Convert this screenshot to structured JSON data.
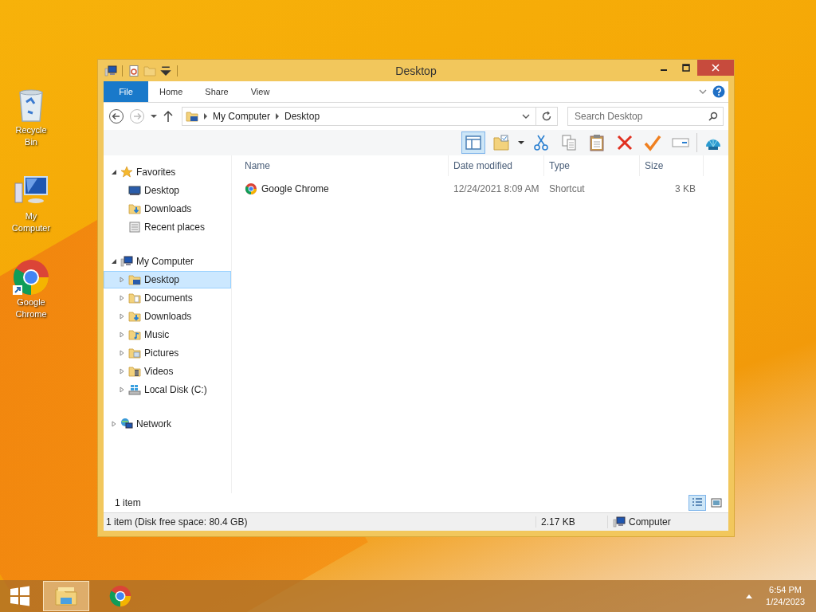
{
  "desktop_icons": [
    {
      "kind": "recycle",
      "label": "Recycle Bin"
    },
    {
      "kind": "computer",
      "label": "My Computer"
    },
    {
      "kind": "chrome",
      "label": "Google Chrome"
    }
  ],
  "window": {
    "title": "Desktop",
    "quick_access": [
      {
        "kind": "properties"
      },
      {
        "kind": "folder"
      }
    ],
    "ribbon_tabs": [
      {
        "label": "File",
        "kind": "menu",
        "selected": false
      },
      {
        "label": "Home",
        "kind": "tab",
        "selected": false
      },
      {
        "label": "Share",
        "kind": "tab",
        "selected": false
      },
      {
        "label": "View",
        "kind": "tab",
        "selected": false
      }
    ],
    "address": {
      "path": [
        "My Computer",
        "Desktop"
      ]
    },
    "search": {
      "placeholder": "Search Desktop"
    },
    "preview_pane": {
      "on": true
    },
    "toolbar": [
      {
        "kind": "newfolder"
      },
      {
        "kind": "cut"
      },
      {
        "kind": "copy"
      },
      {
        "kind": "paste"
      },
      {
        "kind": "delete"
      },
      {
        "kind": "check"
      },
      {
        "kind": "rename"
      },
      {
        "kind": "shell"
      }
    ],
    "nav": [
      {
        "label": "Favorites",
        "kind": "star",
        "expanded": true,
        "selected": false,
        "children": [
          {
            "label": "Desktop",
            "kind": "desktop",
            "selected": false
          },
          {
            "label": "Downloads",
            "kind": "downloads",
            "selected": false
          },
          {
            "label": "Recent places",
            "kind": "recent",
            "selected": false
          }
        ]
      },
      {
        "label": "My Computer",
        "kind": "computer",
        "expanded": true,
        "selected": false,
        "children": [
          {
            "label": "Desktop",
            "kind": "desktopfolder",
            "expanded": false,
            "selected": true
          },
          {
            "label": "Documents",
            "kind": "documents",
            "expanded": false,
            "selected": false
          },
          {
            "label": "Downloads",
            "kind": "downloads",
            "expanded": false,
            "selected": false
          },
          {
            "label": "Music",
            "kind": "music",
            "expanded": false,
            "selected": false
          },
          {
            "label": "Pictures",
            "kind": "pictures",
            "expanded": false,
            "selected": false
          },
          {
            "label": "Videos",
            "kind": "videos",
            "expanded": false,
            "selected": false
          },
          {
            "label": "Local Disk (C:)",
            "kind": "drive",
            "expanded": false,
            "selected": false
          }
        ]
      },
      {
        "label": "Network",
        "kind": "network",
        "expanded": false,
        "selected": false
      }
    ],
    "columns": [
      "Name",
      "Date modified",
      "Type",
      "Size"
    ],
    "files": [
      {
        "name": "Google Chrome",
        "kind": "chrome",
        "date": "12/24/2021 8:09 AM",
        "type": "Shortcut",
        "size": "3 KB"
      }
    ],
    "item_count": "1 item",
    "views": [
      {
        "kind": "details",
        "selected": true
      },
      {
        "kind": "thumbnails",
        "selected": false
      }
    ],
    "status_bar": {
      "info": "1 item (Disk free space: 80.4 GB)",
      "size": "2.17 KB",
      "location": "Computer"
    }
  },
  "taskbar": {
    "apps": [
      {
        "kind": "explorer",
        "selected": true
      },
      {
        "kind": "chrome",
        "selected": false
      }
    ],
    "time": "6:54 PM",
    "date": "1/24/2023"
  }
}
